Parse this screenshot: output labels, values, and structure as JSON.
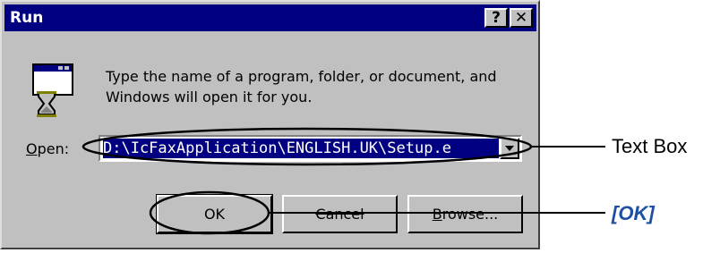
{
  "dialog": {
    "title": "Run",
    "help_button": "?",
    "close_button": "✕",
    "instruction": "Type the name of a program, folder, or document, and Windows will open it for you.",
    "open_label_accel": "O",
    "open_label_rest": "pen:",
    "open_value": "D:\\IcFaxApplication\\ENGLISH.UK\\Setup.e",
    "ok_label": "OK",
    "cancel_label": "Cancel",
    "browse_accel": "B",
    "browse_rest": "rowse..."
  },
  "callouts": {
    "textbox": "Text Box",
    "ok": "[OK]"
  },
  "colors": {
    "titlebar": "#000080",
    "dialog_face": "#c0c0c0",
    "callout_ok": "#1e4fa3"
  }
}
